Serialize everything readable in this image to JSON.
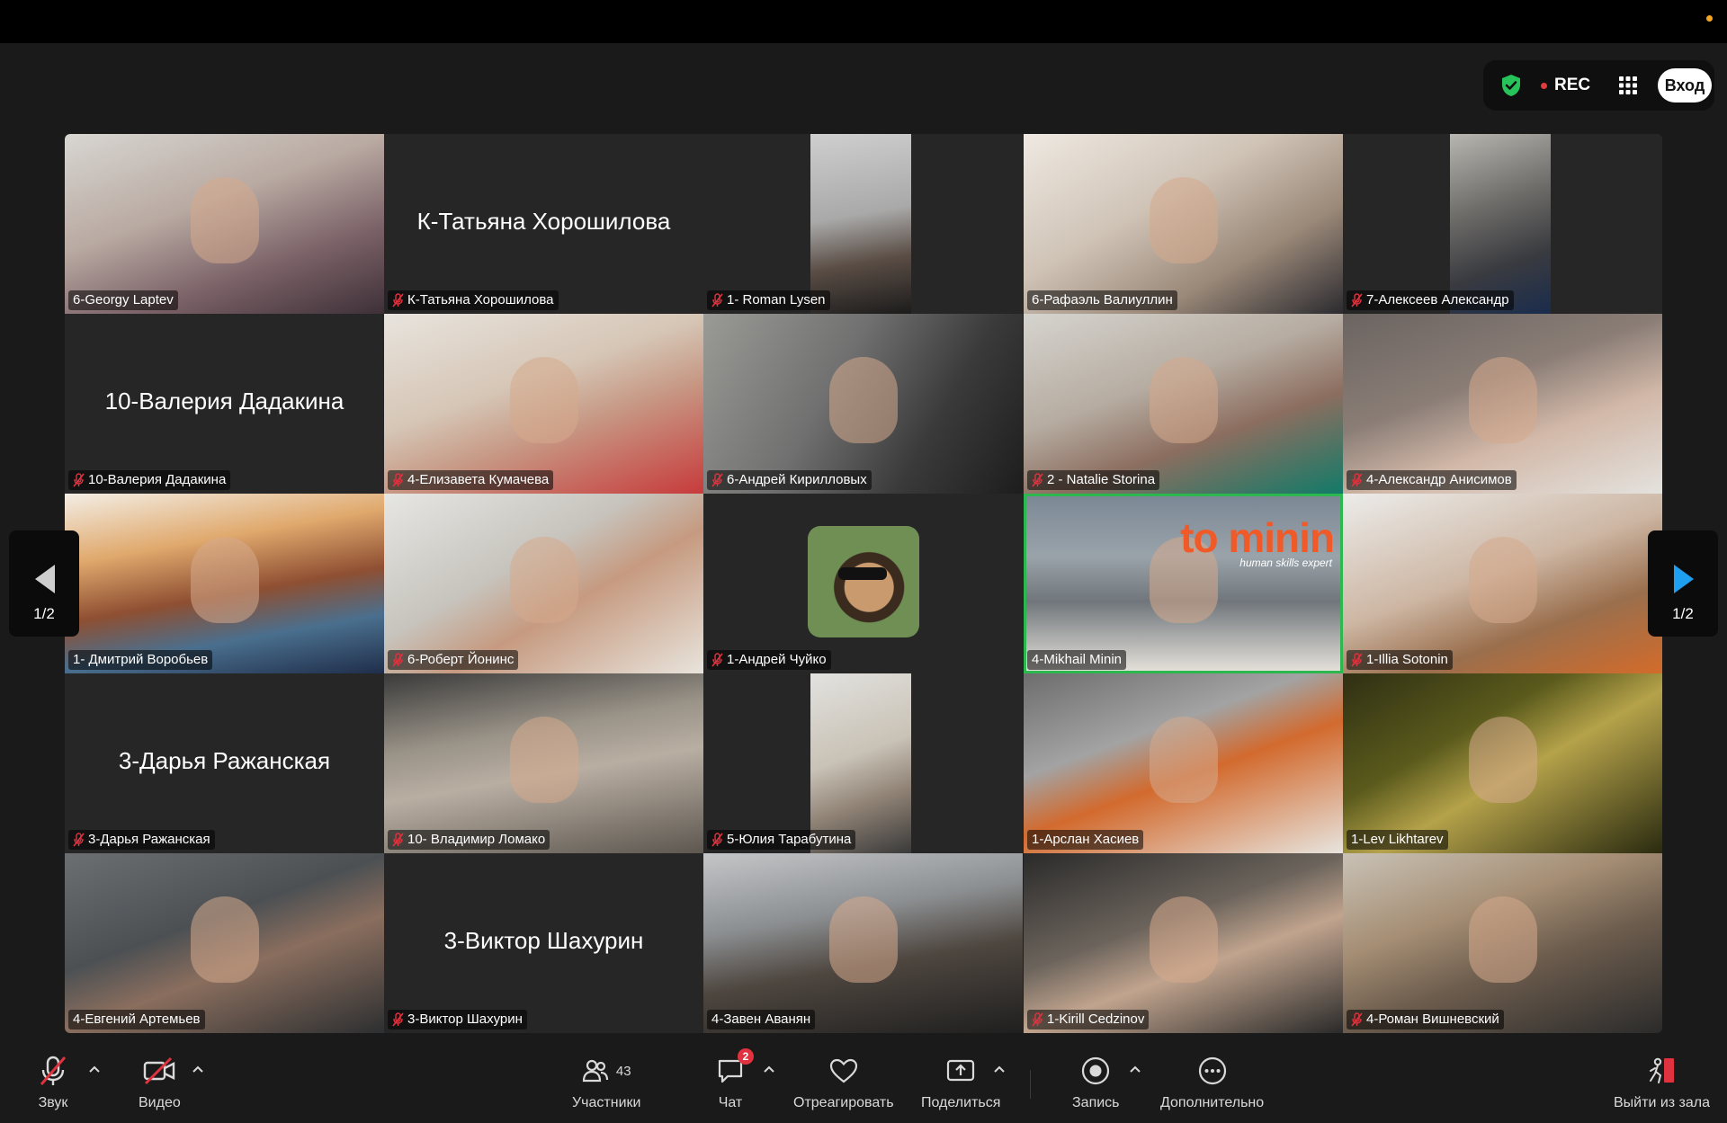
{
  "toolbar_top": {
    "rec_label": "REC",
    "enter_label": "Вход"
  },
  "pager": {
    "left_count": "1/2",
    "right_count": "1/2"
  },
  "participants": [
    {
      "label": "6-Georgy Laptev",
      "muted": false,
      "video": true,
      "bg": "linear-gradient(160deg,#d8d6d2 0%,#b9aaa2 40%,#7b6268 70%,#3e3037 100%)"
    },
    {
      "label": "К-Татьяна Хорошилова",
      "muted": true,
      "video": false,
      "display_name": "К-Татьяна Хорошилова"
    },
    {
      "label": "1- Roman Lysen",
      "muted": true,
      "video": true,
      "bg": "linear-gradient(180deg,#262626 0%,#262626 100%)",
      "inset": "linear-gradient(170deg,#cfcfcf 0%,#a9a9a9 45%,#5a4d45 70%,#1c1c1c 100%)"
    },
    {
      "label": "6-Рафаэль Валиуллин",
      "muted": false,
      "video": true,
      "bg": "linear-gradient(150deg,#efe9e2 0%,#cfc3b6 40%,#9a8878 70%,#2c2b30 100%)"
    },
    {
      "label": "7-Алексеев Александр",
      "muted": true,
      "video": true,
      "bg": "linear-gradient(180deg,#262626 0%,#262626 100%)",
      "inset": "linear-gradient(160deg,#b8b6b0 0%,#6d6b68 40%,#3a3b40 70%,#1a2c4c 100%)"
    },
    {
      "label": "10-Валерия Дадакина",
      "muted": true,
      "video": false,
      "display_name": "10-Валерия Дадакина"
    },
    {
      "label": "4-Елизавета Кумачева",
      "muted": true,
      "video": true,
      "bg": "linear-gradient(160deg,#e8e4de 0%,#d6c6b6 40%,#c79b87 60%,#c73b3b 100%)"
    },
    {
      "label": "6-Андрей Кирилловых",
      "muted": true,
      "video": true,
      "bg": "linear-gradient(120deg,#9a9a96 0%,#707070 40%,#3a3a3a 70%,#1d1d1d 100%)"
    },
    {
      "label": "2 - Natalie Storina",
      "muted": true,
      "video": true,
      "bg": "linear-gradient(160deg,#d6d4cf 0%,#b6aca1 40%,#8c6e60 65%,#127a68 100%)"
    },
    {
      "label": "4-Александр Анисимов",
      "muted": true,
      "video": true,
      "bg": "linear-gradient(160deg,#6b6461 0%,#8a7d76 40%,#d2b8a8 65%,#e4e2de 100%)"
    },
    {
      "label": "1- Дмитрий Воробьев",
      "muted": false,
      "video": true,
      "bg": "linear-gradient(170deg,#f3eee5 0%,#e0a96d 30%,#8e4f32 55%,#4a6f8e 75%,#1f2e4a 100%)"
    },
    {
      "label": "6-Роберт Йонинс",
      "muted": true,
      "video": true,
      "bg": "linear-gradient(150deg,#e6e6e3 0%,#c7c4bd 40%,#c69a80 60%,#e8e4dc 100%)"
    },
    {
      "label": "1-Андрей Чуйко",
      "muted": true,
      "video": false,
      "avatar": true
    },
    {
      "label": "4-Mikhail Minin",
      "muted": false,
      "video": true,
      "active": true,
      "brand": "to minin",
      "brand_sub": "human skills expert",
      "bg": "linear-gradient(180deg,#7a8794 0%,#9aa3aa 35%,#70767b 60%,#e8e4dd 100%)"
    },
    {
      "label": "1-Illia Sotonin",
      "muted": true,
      "video": true,
      "bg": "linear-gradient(160deg,#ececea 0%,#cdb6a3 45%,#9a6f4d 70%,#d36b2a 100%)"
    },
    {
      "label": "3-Дарья Ражанская",
      "muted": true,
      "video": false,
      "display_name": "3-Дарья Ражанская"
    },
    {
      "label": "10- Владимир Ломако",
      "muted": true,
      "video": true,
      "bg": "linear-gradient(170deg,#3a3a3a 0%,#9a9388 35%,#b9aea2 55%,#5d5750 100%)"
    },
    {
      "label": "5-Юлия Тарабутина",
      "muted": true,
      "video": true,
      "bg": "linear-gradient(180deg,#262626 0%,#262626 100%)",
      "inset": "linear-gradient(160deg,#e2e2df 0%,#c9c2b6 45%,#8e8174 70%,#3a3a3a 100%)"
    },
    {
      "label": "1-Арслан Хасиев",
      "muted": false,
      "video": true,
      "bg": "linear-gradient(160deg,#6d6d6d 0%,#a3a3a3 35%,#d26a2e 55%,#e7e4de 100%)"
    },
    {
      "label": "1-Lev Likhtarev",
      "muted": false,
      "video": true,
      "bg": "linear-gradient(150deg,#2f2f14 0%,#5a5a1c 35%,#b5a24a 55%,#2a2b10 100%)"
    },
    {
      "label": "4-Евгений Артемьев",
      "muted": false,
      "video": true,
      "bg": "linear-gradient(160deg,#6b6f72 0%,#4c5053 40%,#8a6e5e 60%,#2d2f31 100%)"
    },
    {
      "label": "3-Виктор Шахурин",
      "muted": true,
      "video": false,
      "display_name": "3-Виктор Шахурин"
    },
    {
      "label": "4-Завен Аванян",
      "muted": false,
      "video": true,
      "bg": "linear-gradient(170deg,#c4c6c8 0%,#8c8f92 35%,#4e463f 60%,#1f1f1f 100%)"
    },
    {
      "label": "1-Kirill Cedzinov",
      "muted": true,
      "video": true,
      "bg": "linear-gradient(160deg,#2a2a2a 0%,#6c645c 40%,#c1a48e 60%,#2a2a2a 100%)"
    },
    {
      "label": "4-Роман Вишневский",
      "muted": true,
      "video": true,
      "bg": "linear-gradient(160deg,#c9c2b6 0%,#a58e74 35%,#6c5c4d 60%,#2b2b2b 100%)"
    }
  ],
  "toolbar": {
    "audio_label": "Звук",
    "video_label": "Видео",
    "participants_label": "Участники",
    "participants_count": "43",
    "chat_label": "Чат",
    "chat_badge": "2",
    "react_label": "Отреагировать",
    "share_label": "Поделиться",
    "record_label": "Запись",
    "more_label": "Дополнительно",
    "leave_label": "Выйти из зала"
  },
  "colors": {
    "active_speaker": "#2cb84f",
    "muted_icon": "#e0323f",
    "pager_arrow_right": "#1f9ff0",
    "secure_shield": "#27c25a"
  }
}
